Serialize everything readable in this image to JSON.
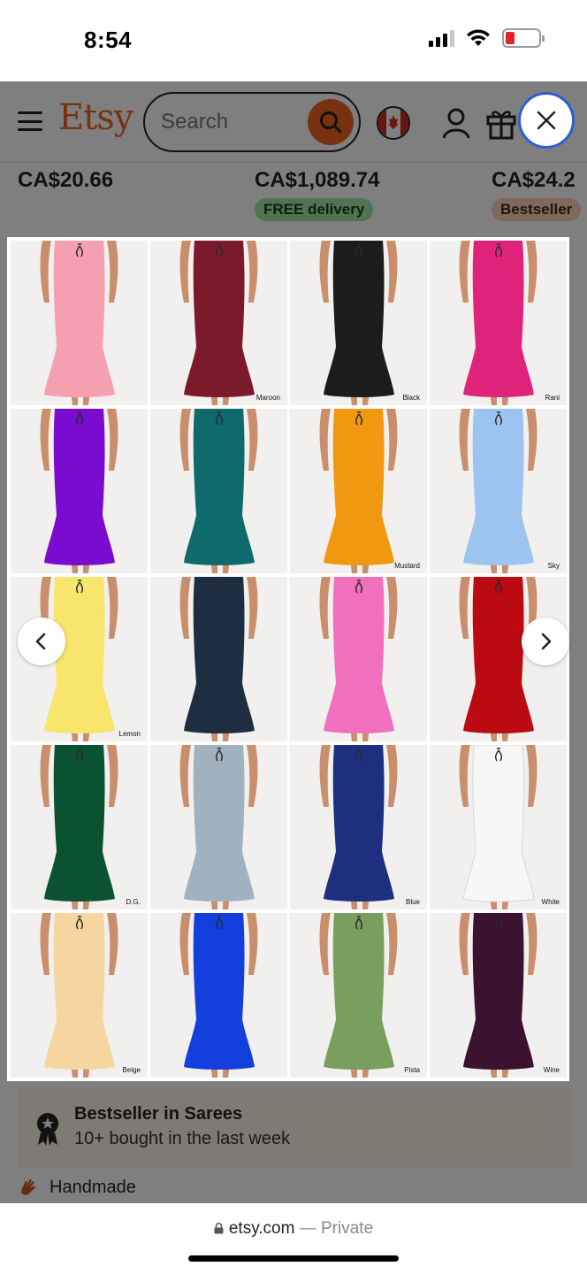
{
  "status_bar": {
    "time": "8:54"
  },
  "header": {
    "logo": "Etsy",
    "search_placeholder": "Search"
  },
  "prices": [
    {
      "amount": "CA$20.66"
    },
    {
      "amount": "CA$1,089.74",
      "badge": "FREE delivery"
    },
    {
      "amount": "CA$24.2",
      "badge": "Bestseller"
    }
  ],
  "gallery": {
    "swatches": [
      {
        "color": "#f4a0b0",
        "label": ""
      },
      {
        "color": "#7a1a2b",
        "label": "Maroon"
      },
      {
        "color": "#1c1c1c",
        "label": "Black"
      },
      {
        "color": "#e0237a",
        "label": "Rani"
      },
      {
        "color": "#7a0ccf",
        "label": ""
      },
      {
        "color": "#0f6b6b",
        "label": ""
      },
      {
        "color": "#f0980f",
        "label": "Mustard"
      },
      {
        "color": "#9cc4ee",
        "label": "Sky"
      },
      {
        "color": "#f7e56c",
        "label": "Lemon"
      },
      {
        "color": "#1c2e40",
        "label": ""
      },
      {
        "color": "#f170bd",
        "label": ""
      },
      {
        "color": "#bb0a12",
        "label": ""
      },
      {
        "color": "#0b5232",
        "label": "D.G."
      },
      {
        "color": "#a0b2bf",
        "label": ""
      },
      {
        "color": "#1e2f80",
        "label": "Blue"
      },
      {
        "color": "#f7f7f7",
        "label": "White"
      },
      {
        "color": "#f5d6a0",
        "label": "Beige"
      },
      {
        "color": "#1340dd",
        "label": ""
      },
      {
        "color": "#7a9e5d",
        "label": "Pista"
      },
      {
        "color": "#3b1230",
        "label": "Wine"
      }
    ]
  },
  "bestseller": {
    "title": "Bestseller in Sarees",
    "subtitle": "10+ bought in the last week"
  },
  "handmade": "Handmade",
  "browser": {
    "domain": "etsy.com",
    "mode": " — Private"
  }
}
